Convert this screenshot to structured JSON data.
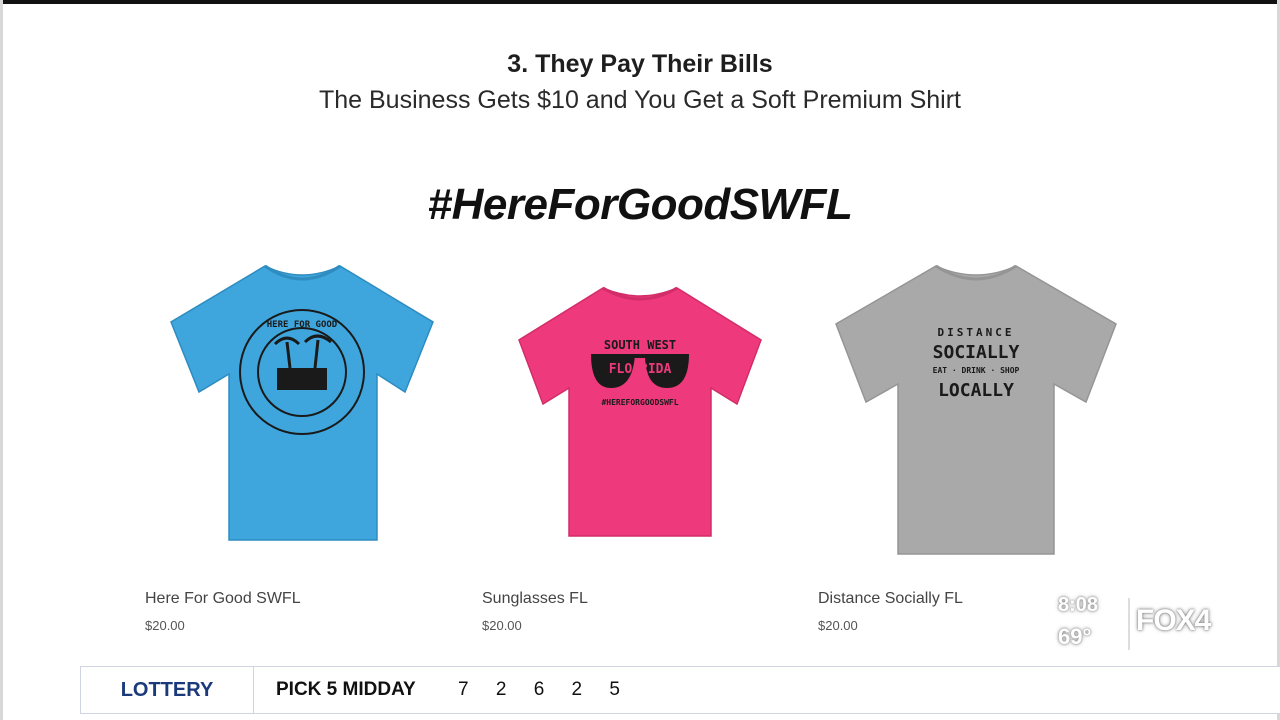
{
  "page": {
    "step_title": "3. They Pay Their Bills",
    "step_subtitle": "The Business Gets $10 and You Get a Soft Premium Shirt",
    "hashtag": "#HereForGoodSWFL"
  },
  "products": [
    {
      "name": "Here For Good SWFL",
      "price": "$20.00",
      "shirt_color": "#3ea6dd",
      "print_text": "HERE FOR GOOD"
    },
    {
      "name": "Sunglasses FL",
      "price": "$20.00",
      "shirt_color": "#ee3a7c",
      "print_line1": "SOUTH WEST",
      "print_line2": "FLO RIDA",
      "print_line3": "#HEREFORGOODSWFL"
    },
    {
      "name": "Distance Socially FL",
      "price": "$20.00",
      "shirt_color": "#a9a9a9",
      "print_line1": "DISTANCE",
      "print_line2": "SOCIALLY",
      "print_line3": "EAT · DRINK · SHOP",
      "print_line4": "LOCALLY"
    }
  ],
  "broadcast": {
    "time": "8:08",
    "temperature": "69°",
    "station_logo": "FOX4",
    "ticker_label": "LOTTERY",
    "ticker_game": "PICK 5 MIDDAY",
    "ticker_numbers": "7 2 6 2 5",
    "ticker_label_color": "#1b3a7a"
  }
}
